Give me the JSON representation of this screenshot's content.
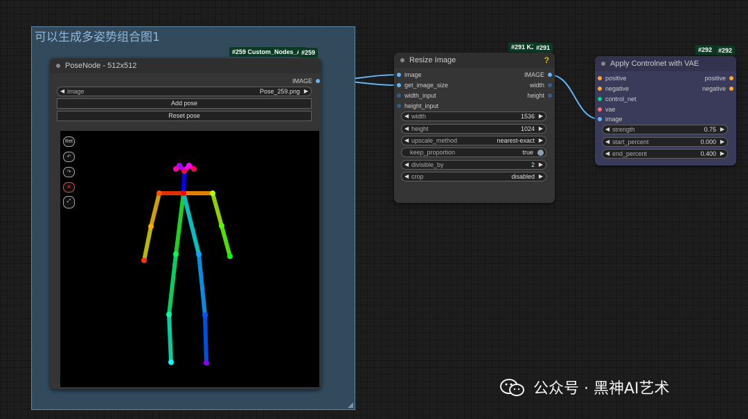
{
  "group": {
    "title": "可以生成多姿势组合图1"
  },
  "badges": {
    "pose_node_type": "#259 Custom_Nodes_AI",
    "pose_node_id": "#259",
    "resize_type": "#291 KJ",
    "resize_id": "#291",
    "apply_type": "#292",
    "apply_id": "#292"
  },
  "pose_node": {
    "title": "PoseNode - 512x512",
    "output_label": "IMAGE",
    "image_widget": {
      "label": "image",
      "value": "Pose_259.png"
    },
    "add_pose_label": "Add pose",
    "reset_pose_label": "Reset pose",
    "tools": {
      "reset": "Ret",
      "undo": "↶",
      "redo": "↷",
      "remove": "✕",
      "expand": "⤢"
    }
  },
  "resize_node": {
    "title": "Resize Image",
    "help": "?",
    "inputs": [
      "image",
      "get_image_size",
      "width_input",
      "height_input"
    ],
    "outputs": [
      "IMAGE",
      "width",
      "height"
    ],
    "widgets": [
      {
        "label": "width",
        "value": "1536"
      },
      {
        "label": "height",
        "value": "1024"
      },
      {
        "label": "upscale_method",
        "value": "nearest-exact"
      },
      {
        "label": "keep_proportion",
        "value": "true"
      },
      {
        "label": "divisible_by",
        "value": "2"
      },
      {
        "label": "crop",
        "value": "disabled"
      }
    ]
  },
  "apply_node": {
    "title": "Apply Controlnet with VAE",
    "inputs": [
      "positive",
      "negative",
      "control_net",
      "vae",
      "image"
    ],
    "outputs": [
      "positive",
      "negative"
    ],
    "widgets": [
      {
        "label": "strength",
        "value": "0.75"
      },
      {
        "label": "start_percent",
        "value": "0.000"
      },
      {
        "label": "end_percent",
        "value": "0.400"
      }
    ]
  },
  "watermark": {
    "text": "公众号 · 黑神AI艺术"
  },
  "colors": {
    "image_slot": "#64b5f6",
    "int_slot": "#2f5f8f",
    "conditioning_slot": "#ffa931",
    "control_net_slot": "#00d68f",
    "vae_slot": "#ff6e6e",
    "link": "#64b5f6",
    "group_bg": "#324a5c"
  },
  "icons": {
    "collapse_dot": "circle-dot-icon",
    "left_arrow": "triangle-left-icon",
    "right_arrow": "triangle-right-icon",
    "help": "question-mark-icon",
    "wechat": "wechat-logo"
  }
}
